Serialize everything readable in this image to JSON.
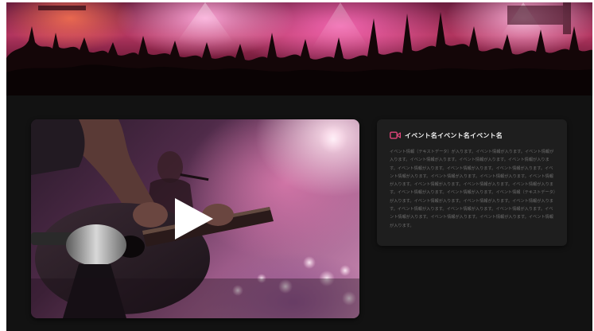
{
  "hero": {
    "image": "concert-crowd-image",
    "accent_color": "#c43a6e"
  },
  "video": {
    "thumbnail": "acoustic-guitar-performance-image",
    "play_icon": "play-icon"
  },
  "event": {
    "icon": "video-camera-icon",
    "icon_color": "#e0457b",
    "title": "イベント名イベント名イベント名",
    "description": "イベント情報（テキストデータ）が入ります。イベント情報が入ります。イベント情報が入ります。イベント情報が入ります。イベント情報が入ります。イベント情報が入ります。イベント情報が入ります。イベント情報が入ります。イベント情報が入ります。イベント情報が入ります。イベント情報が入ります。イベント情報が入ります。イベント情報が入ります。イベント情報が入ります。イベント情報が入ります。イベント情報が入ります。イベント情報が入ります。イベント情報が入ります。イベント情報（テキストデータ）が入ります。イベント情報が入ります。イベント情報が入ります。イベント情報が入ります。イベント情報が入ります。イベント情報が入ります。イベント情報が入ります。イベント情報が入ります。イベント情報が入ります。イベント情報が入ります。イベント情報が入ります。"
  }
}
